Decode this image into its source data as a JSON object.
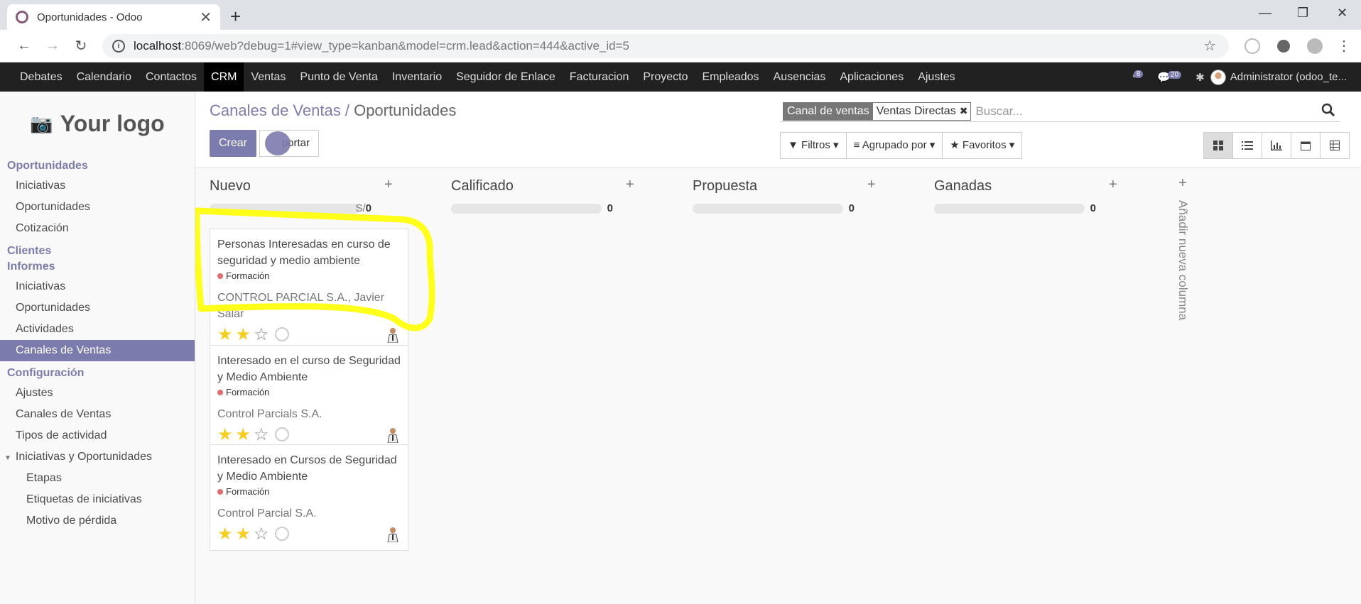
{
  "browser": {
    "tab_title": "Oportunidades - Odoo",
    "url_host": "localhost",
    "url_path": ":8069/web?debug=1#view_type=kanban&model=crm.lead&action=444&active_id=5"
  },
  "topnav": {
    "items": [
      "Debates",
      "Calendario",
      "Contactos",
      "CRM",
      "Ventas",
      "Punto de Venta",
      "Inventario",
      "Seguidor de Enlace",
      "Facturacion",
      "Proyecto",
      "Empleados",
      "Ausencias",
      "Aplicaciones",
      "Ajustes"
    ],
    "active": "CRM",
    "activity_count": "8",
    "message_count": "20",
    "user": "Administrator (odoo_te..."
  },
  "sidebar": {
    "logo_text": "Your logo",
    "sections": [
      {
        "header": "Oportunidades",
        "items": [
          "Iniciativas",
          "Oportunidades",
          "Cotización"
        ]
      },
      {
        "header": "Clientes",
        "items": []
      },
      {
        "header": "Informes",
        "items": [
          "Iniciativas",
          "Oportunidades",
          "Actividades",
          "Canales de Ventas"
        ]
      },
      {
        "header": "Configuración",
        "items": [
          "Ajustes",
          "Canales de Ventas",
          "Tipos de actividad",
          "Iniciativas y Oportunidades",
          "Etapas",
          "Etiquetas de iniciativas",
          "Motivo de pérdida"
        ]
      }
    ],
    "active_item": "Canales de Ventas"
  },
  "breadcrumb": {
    "parent": "Canales de Ventas",
    "separator": "/",
    "current": "Oportunidades"
  },
  "buttons": {
    "create": "Crear",
    "import": "Importar",
    "import_visible": "portar"
  },
  "search": {
    "facet_label": "Canal de ventas",
    "facet_value": "Ventas Directas",
    "placeholder": "Buscar..."
  },
  "filters": {
    "filtros": "Filtros",
    "agrupado": "Agrupado por",
    "favoritos": "Favoritos"
  },
  "columns": [
    {
      "title": "Nuevo",
      "sum_prefix": "S/",
      "sum": "0"
    },
    {
      "title": "Calificado",
      "sum_prefix": "",
      "sum": "0"
    },
    {
      "title": "Propuesta",
      "sum_prefix": "",
      "sum": "0"
    },
    {
      "title": "Ganadas",
      "sum_prefix": "",
      "sum": "0"
    }
  ],
  "cards": [
    {
      "title": "Personas Interesadas en curso de seguridad y medio ambiente",
      "tag": "Formación",
      "partner": "CONTROL PARCIAL S.A., Javier Salar",
      "stars": 2
    },
    {
      "title": "Interesado en el curso de Seguridad y Medio Ambiente",
      "tag": "Formación",
      "partner": "Control Parcials S.A.",
      "stars": 2
    },
    {
      "title": "Interesado en Cursos de Seguridad y Medio Ambiente",
      "tag": "Formación",
      "partner": "Control Parcial S.A.",
      "stars": 2
    }
  ],
  "add_column": "Añadir nueva columna",
  "colors": {
    "brand": "#7c7bad",
    "highlight": "#ffff00",
    "nav_bg": "#212121"
  }
}
